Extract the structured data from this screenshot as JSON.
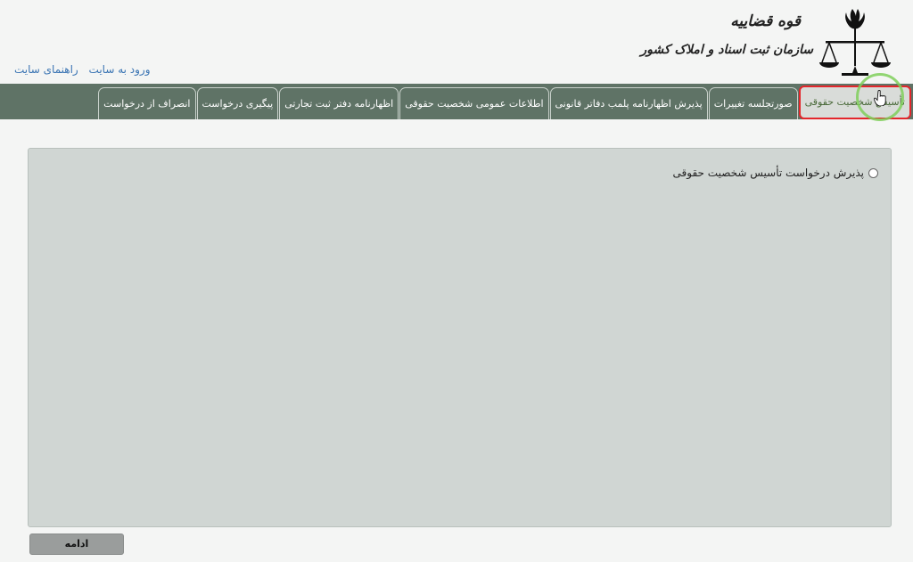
{
  "header": {
    "org_line1": "قوه قضاییه",
    "org_line2": "سازمان ثبت اسناد و املاک کشور",
    "emblem_icon": "iran-emblem-scales-icon"
  },
  "top_links": {
    "login": "ورود به سایت",
    "help": "راهنمای سایت"
  },
  "nav": {
    "tabs": [
      {
        "label": "تأسیس شخصیت حقوقی",
        "active": true
      },
      {
        "label": "صورتجلسه تغییرات"
      },
      {
        "label": "پذیرش اظهارنامه پلمب دفاتر قانونی"
      },
      {
        "label": "اطلاعات عمومی شخصیت حقوقی"
      },
      {
        "label": "اظهارنامه دفتر ثبت تجارتی"
      },
      {
        "label": "پیگیری درخواست"
      },
      {
        "label": "انصراف از درخواست"
      }
    ]
  },
  "panel": {
    "radio_label": "پذیرش درخواست تأسیس شخصیت حقوقی"
  },
  "actions": {
    "continue": "ادامه"
  },
  "colors": {
    "navbar": "#5f7366",
    "active_border": "#e3262b",
    "panel_bg": "#d0d6d3",
    "link": "#3a74b3"
  }
}
